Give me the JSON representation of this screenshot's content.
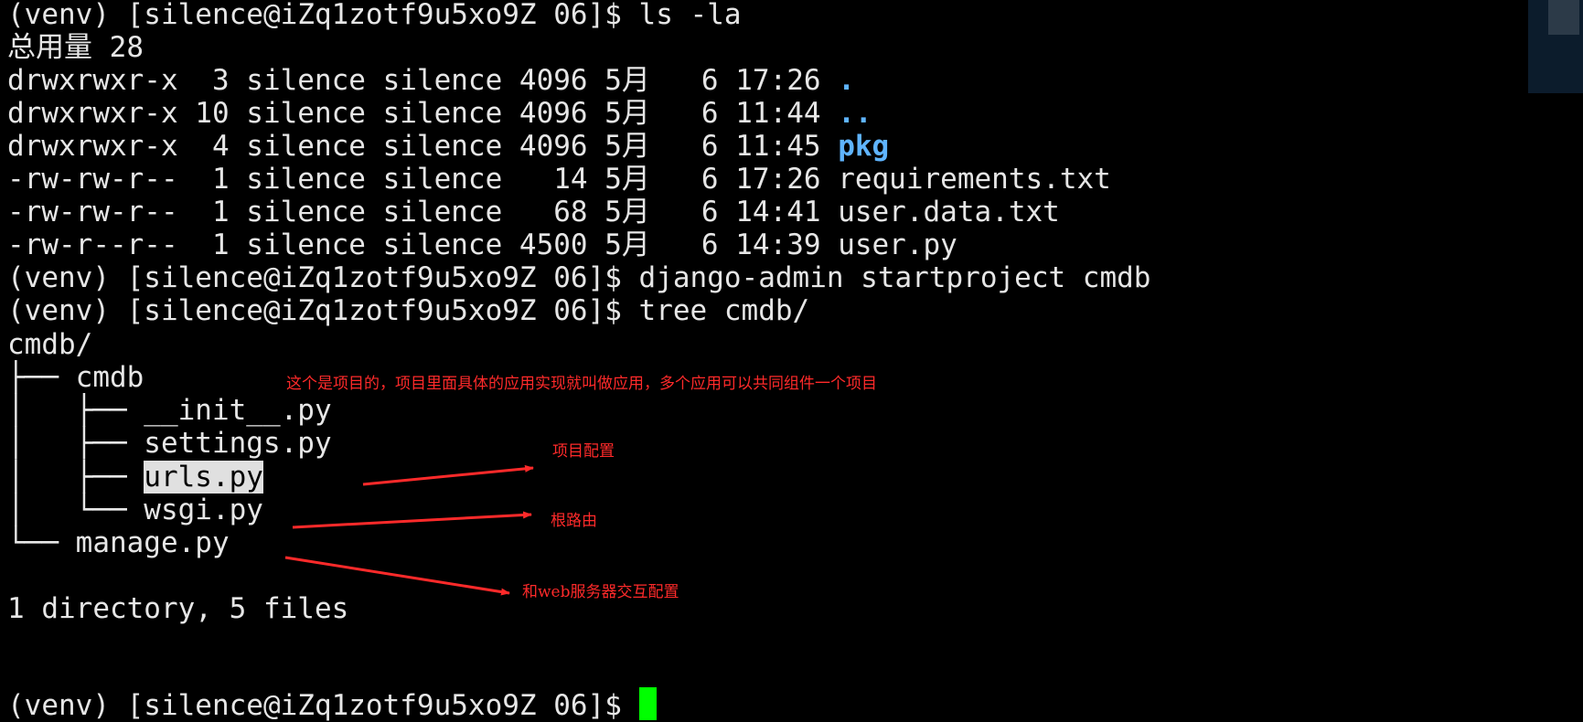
{
  "terminal": {
    "lines": [
      {
        "text": "(venv) [silence@iZq1zotf9u5xo9Z 06]$ ls -la"
      },
      {
        "text": "总用量 28"
      },
      {
        "prefix": "drwxrwxr-x  3 silence silence 4096 5月   6 17:26 ",
        "name": "."
      },
      {
        "prefix": "drwxrwxr-x 10 silence silence 4096 5月   6 11:44 ",
        "name": ".."
      },
      {
        "prefix": "drwxrwxr-x  4 silence silence 4096 5月   6 11:45 ",
        "name": "pkg"
      },
      {
        "text": "-rw-rw-r--  1 silence silence   14 5月   6 17:26 requirements.txt"
      },
      {
        "text": "-rw-rw-r--  1 silence silence   68 5月   6 14:41 user.data.txt"
      },
      {
        "text": "-rw-r--r--  1 silence silence 4500 5月   6 14:39 user.py"
      },
      {
        "text": "(venv) [silence@iZq1zotf9u5xo9Z 06]$ django-admin startproject cmdb"
      },
      {
        "text": "(venv) [silence@iZq1zotf9u5xo9Z 06]$ tree cmdb/"
      },
      {
        "text": "cmdb/"
      },
      {
        "text": "├── cmdb"
      },
      {
        "text": "│   ├── __init__.py"
      },
      {
        "text": "│   ├── settings.py"
      },
      {
        "prefix": "│   ├── ",
        "name": "urls.py"
      },
      {
        "text": "│   └── wsgi.py"
      },
      {
        "text": "└── manage.py"
      },
      {
        "text": ""
      },
      {
        "text": "1 directory, 5 files"
      },
      {
        "text": "(venv) [silence@iZq1zotf9u5xo9Z 06]$ "
      }
    ]
  },
  "annotations": {
    "project_note": "这个是项目的，项目里面具体的应用实现就叫做应用，多个应用可以共同组件一个项目",
    "settings_note": "项目配置",
    "urls_note": "根路由",
    "wsgi_note": "和web服务器交互配置"
  },
  "colors": {
    "background": "#000000",
    "text": "#e6e6e6",
    "directory": "#5fb4ff",
    "annotation": "#ff2a2a",
    "cursor": "#00ff00"
  }
}
